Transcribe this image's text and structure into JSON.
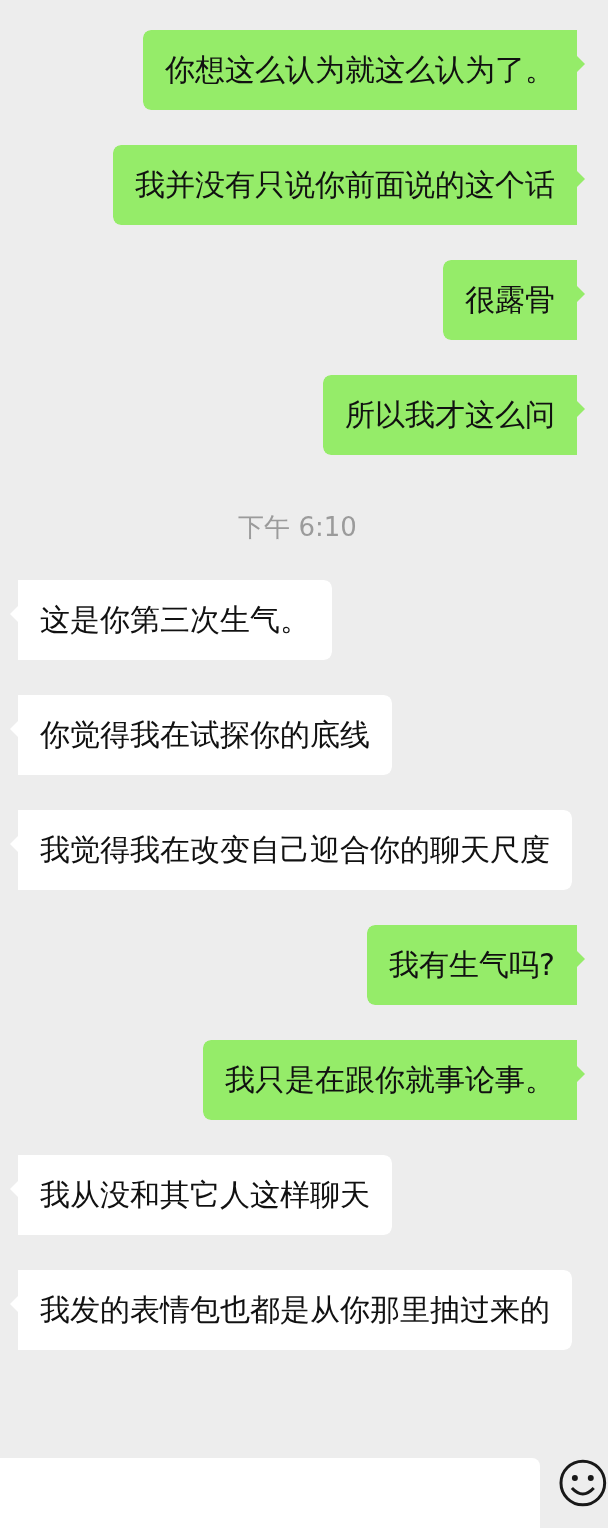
{
  "messages": [
    {
      "kind": "sent",
      "text": "你想这么认为就这么认为了。"
    },
    {
      "kind": "sent",
      "text": "我并没有只说你前面说的这个话"
    },
    {
      "kind": "sent",
      "text": "很露骨"
    },
    {
      "kind": "sent",
      "text": "所以我才这么问"
    },
    {
      "kind": "time",
      "text": "下午 6:10"
    },
    {
      "kind": "received",
      "text": "这是你第三次生气。"
    },
    {
      "kind": "received",
      "text": "你觉得我在试探你的底线"
    },
    {
      "kind": "received",
      "text": "我觉得我在改变自己迎合你的聊天尺度"
    },
    {
      "kind": "sent",
      "text": "我有生气吗?"
    },
    {
      "kind": "sent",
      "text": "我只是在跟你就事论事。"
    },
    {
      "kind": "received",
      "text": "我从没和其它人这样聊天"
    },
    {
      "kind": "received",
      "text": "我发的表情包也都是从你那里抽过来的"
    }
  ]
}
